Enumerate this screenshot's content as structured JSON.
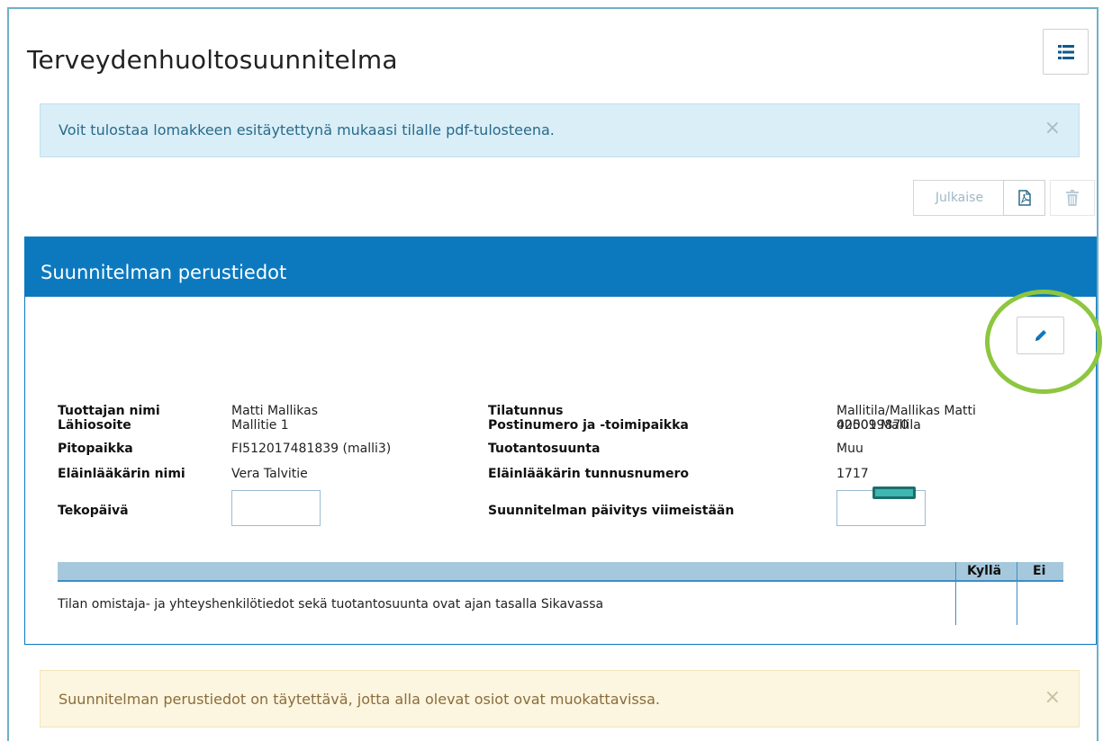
{
  "page": {
    "title": "Terveydenhuoltosuunnitelma"
  },
  "info_alert": {
    "message": "Voit tulostaa lomakkeen esitäytettynä mukaasi tilalle pdf-tulosteena.",
    "close": "×"
  },
  "toolbar": {
    "publish_label": "Julkaise",
    "icons": [
      "list-icon",
      "pdf-icon",
      "trash-icon"
    ]
  },
  "panel": {
    "title": "Suunnitelman perustiedot",
    "edit_icon": "pencil-icon"
  },
  "fields": {
    "producer_name_label": "Tuottajan nimi",
    "producer_name": "Matti Mallikas",
    "address_label": "Lähiosoite",
    "address": "Mallitie 1",
    "location_label": "Pitopaikka",
    "location": "FI512017481839 (malli3)",
    "vet_name_label": "Eläinlääkärin nimi",
    "vet_name": "Vera Talvitie",
    "made_date_label": "Tekopäivä",
    "made_date": "",
    "farm_id_label": "Tilatunnus",
    "farm_id_line1": "Mallitila/Mallikas Matti",
    "farm_id_line2": "425099870",
    "postal_label": "Postinumero ja -toimipaikka",
    "postal": "00001 Mallila",
    "production_label": "Tuotantosuunta",
    "production": "Muu",
    "vet_number_label": "Eläinlääkärin tunnusnumero",
    "vet_number": "1717",
    "update_label": "Suunnitelman päivitys viimeistään",
    "update_date": ""
  },
  "checklist": {
    "headers": {
      "yes": "Kyllä",
      "no": "Ei"
    },
    "rows": [
      "Tilan omistaja- ja yhteyshenkilötiedot sekä tuotantosuunta ovat ajan tasalla Sikavassa"
    ]
  },
  "warning_alert": {
    "message": "Suunnitelman perustiedot on täytettävä, jotta alla olevat osiot ovat muokattavissa.",
    "close": "×"
  },
  "colors": {
    "primary": "#0c79bf",
    "info_bg": "#d9eef7",
    "warning_bg": "#fcf5df",
    "highlight_ring": "#8dc63f"
  }
}
